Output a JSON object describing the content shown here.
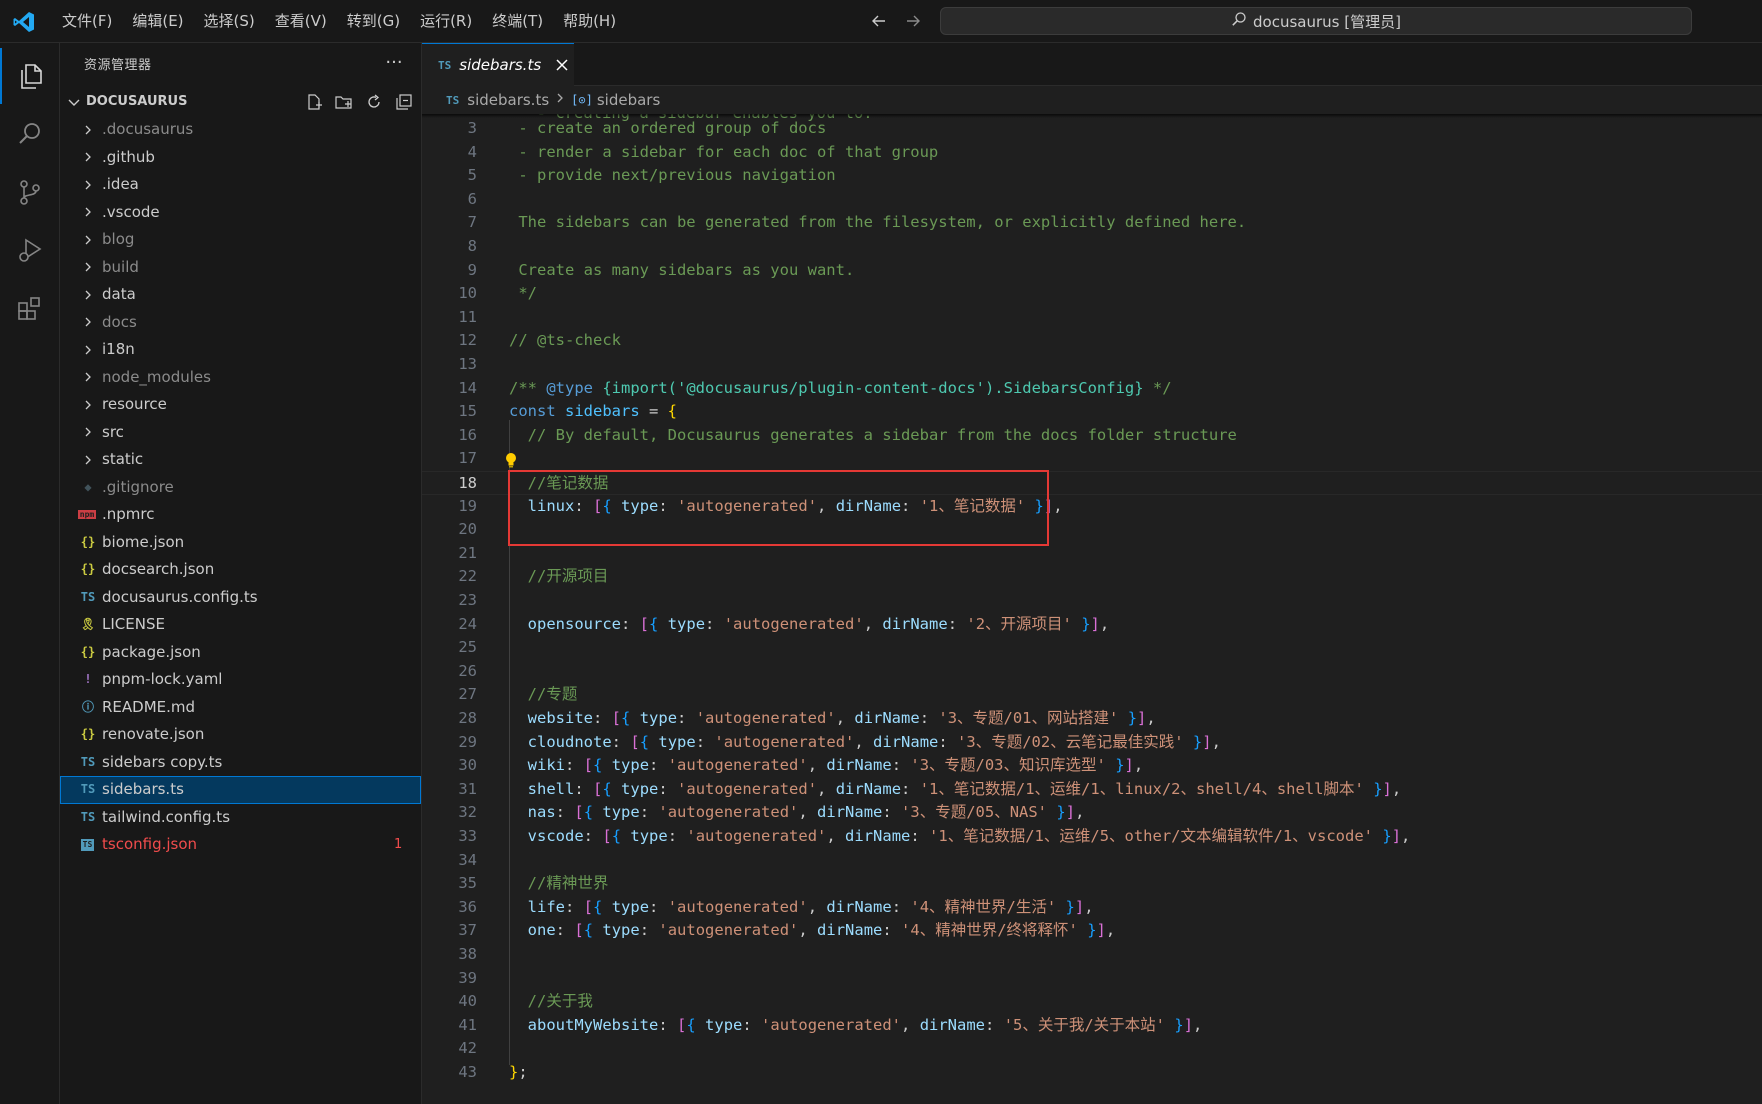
{
  "window": {
    "menus": [
      "文件(F)",
      "编辑(E)",
      "选择(S)",
      "查看(V)",
      "转到(G)",
      "运行(R)",
      "终端(T)",
      "帮助(H)"
    ],
    "search_text": "docusaurus [管理员]"
  },
  "sidebar": {
    "title": "资源管理器",
    "root": "DOCUSAURUS",
    "items": [
      {
        "label": ".docusaurus",
        "kind": "folder",
        "dim": true
      },
      {
        "label": ".github",
        "kind": "folder"
      },
      {
        "label": ".idea",
        "kind": "folder"
      },
      {
        "label": ".vscode",
        "kind": "folder"
      },
      {
        "label": "blog",
        "kind": "folder",
        "dim": true
      },
      {
        "label": "build",
        "kind": "folder",
        "dim": true
      },
      {
        "label": "data",
        "kind": "folder"
      },
      {
        "label": "docs",
        "kind": "folder",
        "dim": true
      },
      {
        "label": "i18n",
        "kind": "folder"
      },
      {
        "label": "node_modules",
        "kind": "folder",
        "dim": true
      },
      {
        "label": "resource",
        "kind": "folder"
      },
      {
        "label": "src",
        "kind": "folder"
      },
      {
        "label": "static",
        "kind": "folder"
      },
      {
        "label": ".gitignore",
        "kind": "git-icon",
        "dim": true
      },
      {
        "label": ".npmrc",
        "kind": "npm-icon"
      },
      {
        "label": "biome.json",
        "kind": "json-icon"
      },
      {
        "label": "docsearch.json",
        "kind": "json-icon"
      },
      {
        "label": "docusaurus.config.ts",
        "kind": "ts-icon"
      },
      {
        "label": "LICENSE",
        "kind": "license-icon"
      },
      {
        "label": "package.json",
        "kind": "json-icon"
      },
      {
        "label": "pnpm-lock.yaml",
        "kind": "yaml-icon"
      },
      {
        "label": "README.md",
        "kind": "info-icon"
      },
      {
        "label": "renovate.json",
        "kind": "json-icon"
      },
      {
        "label": "sidebars copy.ts",
        "kind": "ts-icon"
      },
      {
        "label": "sidebars.ts",
        "kind": "ts-icon",
        "selected": true
      },
      {
        "label": "tailwind.config.ts",
        "kind": "ts-icon"
      },
      {
        "label": "tsconfig.json",
        "kind": "tsconfig-icon",
        "error": true,
        "badge": "1"
      }
    ]
  },
  "editor": {
    "tab": {
      "type": "TS",
      "label": "sidebars.ts"
    },
    "breadcrumb": {
      "type": "TS",
      "file": "sidebars.ts",
      "symbol": "sidebars"
    },
    "current_line": 18,
    "partial_top": "  - creating a sidebar enables you to:",
    "lines": [
      {
        "n": 3,
        "t": [
          [
            "com",
            " - create an ordered group of docs"
          ]
        ]
      },
      {
        "n": 4,
        "t": [
          [
            "com",
            " - render a sidebar for each doc of that group"
          ]
        ]
      },
      {
        "n": 5,
        "t": [
          [
            "com",
            " - provide next/previous navigation"
          ]
        ]
      },
      {
        "n": 6,
        "t": []
      },
      {
        "n": 7,
        "t": [
          [
            "com",
            " The sidebars can be generated from the filesystem, or explicitly defined here."
          ]
        ]
      },
      {
        "n": 8,
        "t": []
      },
      {
        "n": 9,
        "t": [
          [
            "com",
            " Create as many sidebars as you want."
          ]
        ]
      },
      {
        "n": 10,
        "t": [
          [
            "com",
            " */"
          ]
        ]
      },
      {
        "n": 11,
        "t": []
      },
      {
        "n": 12,
        "t": [
          [
            "com",
            "// @ts-check"
          ]
        ]
      },
      {
        "n": 13,
        "t": []
      },
      {
        "n": 14,
        "t": [
          [
            "com",
            "/** "
          ],
          [
            "tag",
            "@type"
          ],
          [
            "com",
            " "
          ],
          [
            "type",
            "{import('@docusaurus/plugin-content-docs').SidebarsConfig}"
          ],
          [
            "com",
            " */"
          ]
        ]
      },
      {
        "n": 15,
        "t": [
          [
            "kw",
            "const"
          ],
          [
            "p",
            " "
          ],
          [
            "var",
            "sidebars"
          ],
          [
            "p",
            " = "
          ],
          [
            "b1",
            "{"
          ]
        ]
      },
      {
        "n": 16,
        "t": [
          [
            "p",
            "  "
          ],
          [
            "com",
            "// By default, Docusaurus generates a sidebar from the docs folder structure"
          ]
        ]
      },
      {
        "n": 17,
        "t": []
      },
      {
        "n": 18,
        "t": [
          [
            "p",
            "  "
          ],
          [
            "com",
            "//笔记数据"
          ]
        ]
      },
      {
        "n": 19,
        "t": [
          [
            "p",
            "  "
          ],
          [
            "prop",
            "linux"
          ],
          [
            "p",
            ": "
          ],
          [
            "b2",
            "["
          ],
          [
            "b3",
            "{"
          ],
          [
            "p",
            " "
          ],
          [
            "prop",
            "type"
          ],
          [
            "p",
            ": "
          ],
          [
            "str",
            "'autogenerated'"
          ],
          [
            "p",
            ", "
          ],
          [
            "prop",
            "dirName"
          ],
          [
            "p",
            ": "
          ],
          [
            "str",
            "'1、笔记数据'"
          ],
          [
            "p",
            " "
          ],
          [
            "b3",
            "}"
          ],
          [
            "b2",
            "]"
          ],
          [
            "p",
            ","
          ]
        ]
      },
      {
        "n": 20,
        "t": []
      },
      {
        "n": 21,
        "t": []
      },
      {
        "n": 22,
        "t": [
          [
            "p",
            "  "
          ],
          [
            "com",
            "//开源项目"
          ]
        ]
      },
      {
        "n": 23,
        "t": []
      },
      {
        "n": 24,
        "t": [
          [
            "p",
            "  "
          ],
          [
            "prop",
            "opensource"
          ],
          [
            "p",
            ": "
          ],
          [
            "b2",
            "["
          ],
          [
            "b3",
            "{"
          ],
          [
            "p",
            " "
          ],
          [
            "prop",
            "type"
          ],
          [
            "p",
            ": "
          ],
          [
            "str",
            "'autogenerated'"
          ],
          [
            "p",
            ", "
          ],
          [
            "prop",
            "dirName"
          ],
          [
            "p",
            ": "
          ],
          [
            "str",
            "'2、开源项目'"
          ],
          [
            "p",
            " "
          ],
          [
            "b3",
            "}"
          ],
          [
            "b2",
            "]"
          ],
          [
            "p",
            ","
          ]
        ]
      },
      {
        "n": 25,
        "t": []
      },
      {
        "n": 26,
        "t": []
      },
      {
        "n": 27,
        "t": [
          [
            "p",
            "  "
          ],
          [
            "com",
            "//专题"
          ]
        ]
      },
      {
        "n": 28,
        "t": [
          [
            "p",
            "  "
          ],
          [
            "prop",
            "website"
          ],
          [
            "p",
            ": "
          ],
          [
            "b2",
            "["
          ],
          [
            "b3",
            "{"
          ],
          [
            "p",
            " "
          ],
          [
            "prop",
            "type"
          ],
          [
            "p",
            ": "
          ],
          [
            "str",
            "'autogenerated'"
          ],
          [
            "p",
            ", "
          ],
          [
            "prop",
            "dirName"
          ],
          [
            "p",
            ": "
          ],
          [
            "str",
            "'3、专题/01、网站搭建'"
          ],
          [
            "p",
            " "
          ],
          [
            "b3",
            "}"
          ],
          [
            "b2",
            "]"
          ],
          [
            "p",
            ","
          ]
        ]
      },
      {
        "n": 29,
        "t": [
          [
            "p",
            "  "
          ],
          [
            "prop",
            "cloudnote"
          ],
          [
            "p",
            ": "
          ],
          [
            "b2",
            "["
          ],
          [
            "b3",
            "{"
          ],
          [
            "p",
            " "
          ],
          [
            "prop",
            "type"
          ],
          [
            "p",
            ": "
          ],
          [
            "str",
            "'autogenerated'"
          ],
          [
            "p",
            ", "
          ],
          [
            "prop",
            "dirName"
          ],
          [
            "p",
            ": "
          ],
          [
            "str",
            "'3、专题/02、云笔记最佳实践'"
          ],
          [
            "p",
            " "
          ],
          [
            "b3",
            "}"
          ],
          [
            "b2",
            "]"
          ],
          [
            "p",
            ","
          ]
        ]
      },
      {
        "n": 30,
        "t": [
          [
            "p",
            "  "
          ],
          [
            "prop",
            "wiki"
          ],
          [
            "p",
            ": "
          ],
          [
            "b2",
            "["
          ],
          [
            "b3",
            "{"
          ],
          [
            "p",
            " "
          ],
          [
            "prop",
            "type"
          ],
          [
            "p",
            ": "
          ],
          [
            "str",
            "'autogenerated'"
          ],
          [
            "p",
            ", "
          ],
          [
            "prop",
            "dirName"
          ],
          [
            "p",
            ": "
          ],
          [
            "str",
            "'3、专题/03、知识库选型'"
          ],
          [
            "p",
            " "
          ],
          [
            "b3",
            "}"
          ],
          [
            "b2",
            "]"
          ],
          [
            "p",
            ","
          ]
        ]
      },
      {
        "n": 31,
        "t": [
          [
            "p",
            "  "
          ],
          [
            "prop",
            "shell"
          ],
          [
            "p",
            ": "
          ],
          [
            "b2",
            "["
          ],
          [
            "b3",
            "{"
          ],
          [
            "p",
            " "
          ],
          [
            "prop",
            "type"
          ],
          [
            "p",
            ": "
          ],
          [
            "str",
            "'autogenerated'"
          ],
          [
            "p",
            ", "
          ],
          [
            "prop",
            "dirName"
          ],
          [
            "p",
            ": "
          ],
          [
            "str",
            "'1、笔记数据/1、运维/1、linux/2、shell/4、shell脚本'"
          ],
          [
            "p",
            " "
          ],
          [
            "b3",
            "}"
          ],
          [
            "b2",
            "]"
          ],
          [
            "p",
            ","
          ]
        ]
      },
      {
        "n": 32,
        "t": [
          [
            "p",
            "  "
          ],
          [
            "prop",
            "nas"
          ],
          [
            "p",
            ": "
          ],
          [
            "b2",
            "["
          ],
          [
            "b3",
            "{"
          ],
          [
            "p",
            " "
          ],
          [
            "prop",
            "type"
          ],
          [
            "p",
            ": "
          ],
          [
            "str",
            "'autogenerated'"
          ],
          [
            "p",
            ", "
          ],
          [
            "prop",
            "dirName"
          ],
          [
            "p",
            ": "
          ],
          [
            "str",
            "'3、专题/05、NAS'"
          ],
          [
            "p",
            " "
          ],
          [
            "b3",
            "}"
          ],
          [
            "b2",
            "]"
          ],
          [
            "p",
            ","
          ]
        ]
      },
      {
        "n": 33,
        "t": [
          [
            "p",
            "  "
          ],
          [
            "prop",
            "vscode"
          ],
          [
            "p",
            ": "
          ],
          [
            "b2",
            "["
          ],
          [
            "b3",
            "{"
          ],
          [
            "p",
            " "
          ],
          [
            "prop",
            "type"
          ],
          [
            "p",
            ": "
          ],
          [
            "str",
            "'autogenerated'"
          ],
          [
            "p",
            ", "
          ],
          [
            "prop",
            "dirName"
          ],
          [
            "p",
            ": "
          ],
          [
            "str",
            "'1、笔记数据/1、运维/5、other/文本编辑软件/1、vscode'"
          ],
          [
            "p",
            " "
          ],
          [
            "b3",
            "}"
          ],
          [
            "b2",
            "]"
          ],
          [
            "p",
            ","
          ]
        ]
      },
      {
        "n": 34,
        "t": []
      },
      {
        "n": 35,
        "t": [
          [
            "p",
            "  "
          ],
          [
            "com",
            "//精神世界"
          ]
        ]
      },
      {
        "n": 36,
        "t": [
          [
            "p",
            "  "
          ],
          [
            "prop",
            "life"
          ],
          [
            "p",
            ": "
          ],
          [
            "b2",
            "["
          ],
          [
            "b3",
            "{"
          ],
          [
            "p",
            " "
          ],
          [
            "prop",
            "type"
          ],
          [
            "p",
            ": "
          ],
          [
            "str",
            "'autogenerated'"
          ],
          [
            "p",
            ", "
          ],
          [
            "prop",
            "dirName"
          ],
          [
            "p",
            ": "
          ],
          [
            "str",
            "'4、精神世界/生活'"
          ],
          [
            "p",
            " "
          ],
          [
            "b3",
            "}"
          ],
          [
            "b2",
            "]"
          ],
          [
            "p",
            ","
          ]
        ]
      },
      {
        "n": 37,
        "t": [
          [
            "p",
            "  "
          ],
          [
            "prop",
            "one"
          ],
          [
            "p",
            ": "
          ],
          [
            "b2",
            "["
          ],
          [
            "b3",
            "{"
          ],
          [
            "p",
            " "
          ],
          [
            "prop",
            "type"
          ],
          [
            "p",
            ": "
          ],
          [
            "str",
            "'autogenerated'"
          ],
          [
            "p",
            ", "
          ],
          [
            "prop",
            "dirName"
          ],
          [
            "p",
            ": "
          ],
          [
            "str",
            "'4、精神世界/终将释怀'"
          ],
          [
            "p",
            " "
          ],
          [
            "b3",
            "}"
          ],
          [
            "b2",
            "]"
          ],
          [
            "p",
            ","
          ]
        ]
      },
      {
        "n": 38,
        "t": []
      },
      {
        "n": 39,
        "t": []
      },
      {
        "n": 40,
        "t": [
          [
            "p",
            "  "
          ],
          [
            "com",
            "//关于我"
          ]
        ]
      },
      {
        "n": 41,
        "t": [
          [
            "p",
            "  "
          ],
          [
            "prop",
            "aboutMyWebsite"
          ],
          [
            "p",
            ": "
          ],
          [
            "b2",
            "["
          ],
          [
            "b3",
            "{"
          ],
          [
            "p",
            " "
          ],
          [
            "prop",
            "type"
          ],
          [
            "p",
            ": "
          ],
          [
            "str",
            "'autogenerated'"
          ],
          [
            "p",
            ", "
          ],
          [
            "prop",
            "dirName"
          ],
          [
            "p",
            ": "
          ],
          [
            "str",
            "'5、关于我/关于本站'"
          ],
          [
            "p",
            " "
          ],
          [
            "b3",
            "}"
          ],
          [
            "b2",
            "]"
          ],
          [
            "p",
            ","
          ]
        ]
      },
      {
        "n": 42,
        "t": []
      },
      {
        "n": 43,
        "t": [
          [
            "b1",
            "}"
          ],
          [
            "p",
            ";"
          ]
        ]
      }
    ]
  }
}
